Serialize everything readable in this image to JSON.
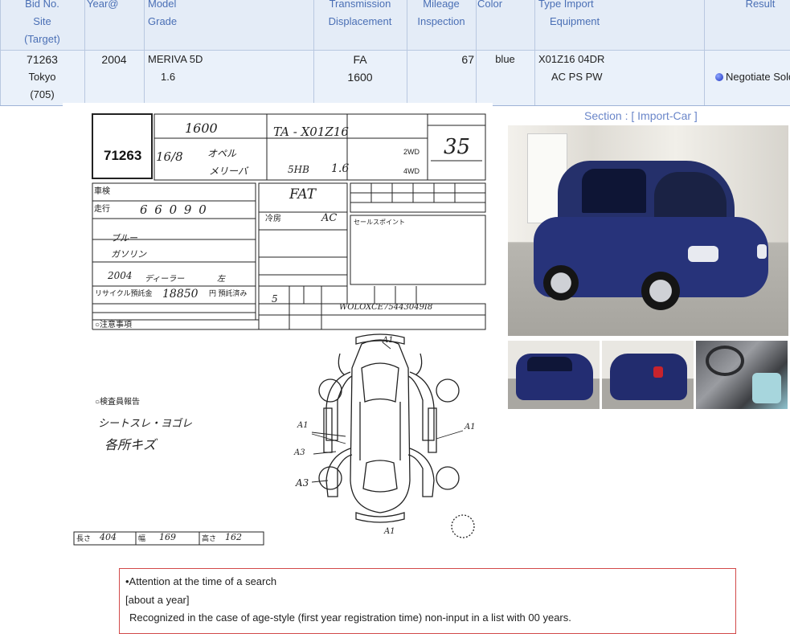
{
  "header": {
    "col1": [
      "Bid No.",
      "Site",
      "(Target)"
    ],
    "col2": [
      "Year@"
    ],
    "col3": [
      "Model",
      "Grade"
    ],
    "col4": [
      "Transmission",
      "Displacement"
    ],
    "col5": [
      "Mileage",
      "Inspection"
    ],
    "col6": [
      "Color"
    ],
    "col7": [
      "Type  Import",
      "Equipment"
    ],
    "col8": [
      "Result"
    ]
  },
  "row": {
    "bid_no": "71263",
    "site": "Tokyo",
    "target": "(705)",
    "year": "2004",
    "model": "MERIVA 5D",
    "grade": "1.6",
    "transmission": "FA",
    "displacement": "1600",
    "mileage": "67",
    "color": "blue",
    "type": "X01Z16  04DR",
    "equipment": "AC PS PW",
    "result": "Negotiate Sold"
  },
  "sheet": {
    "lot_no": "71263",
    "score": "35",
    "type_code": "TA - X01Z16",
    "displacement_hw": "1600",
    "year": "16/8",
    "maker": "オペル",
    "model": "メリーバ",
    "doors": "5HB",
    "grade": "1.6",
    "shift": "FAT",
    "ac": "AC",
    "odometer": "6 6 0 9 0",
    "color": "ブルー",
    "fuel": "ガソリン",
    "model_year": "2004",
    "dealer": "ディーラー",
    "handle": "左",
    "recycle_fee": "18850",
    "capacity": "5",
    "chassis_no": "WOLOXCE75443049I8",
    "inspector_notes": [
      "シートスレ・ヨゴレ",
      "各所キズ"
    ],
    "dimensions": {
      "length": "404",
      "width": "169",
      "height": "162"
    },
    "damage_labels": [
      "A1",
      "A1",
      "A1",
      "A3",
      "A3",
      "A1"
    ],
    "labels": {
      "shaken": "車検",
      "soukou": "走行",
      "notes": "○注意事項",
      "report": "○検査員報告",
      "recycle": "リサイクル預託金",
      "sales_points": "セールスポイント",
      "paid": "円 預託済み",
      "reitou": "冷房",
      "4wd": "4WD",
      "2wd": "2WD",
      "len": "長さ",
      "wid": "幅",
      "hei": "高さ"
    }
  },
  "section_label": "Section : [ Import-Car ]",
  "notice": {
    "line1": "•Attention at the time of a search",
    "line2": "[about a year]",
    "line3": "Recognized in the case of age-style (first year registration time) non-input in a list with 00 years."
  }
}
